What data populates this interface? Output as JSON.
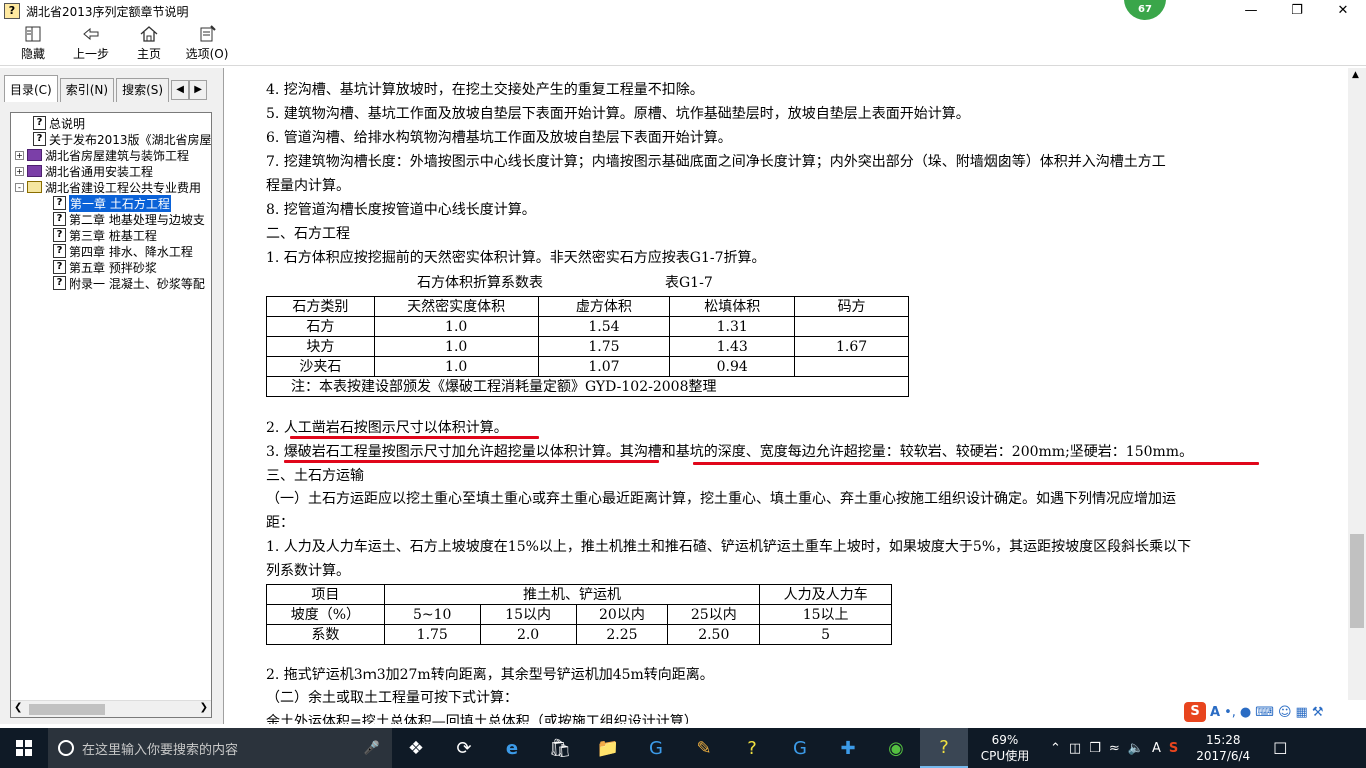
{
  "window": {
    "title": "湖北省2013序列定额章节说明",
    "badge": "67"
  },
  "toolbar": [
    {
      "label": "隐藏",
      "icon": "hide-icon"
    },
    {
      "label": "上一步",
      "icon": "back-arrow-icon"
    },
    {
      "label": "主页",
      "icon": "home-icon"
    },
    {
      "label": "选项(O)",
      "icon": "options-icon"
    }
  ],
  "tabs": [
    "目录(C)",
    "索引(N)",
    "搜索(S)"
  ],
  "tree": [
    {
      "label": "总说明",
      "type": "page",
      "indent": 1
    },
    {
      "label": "关于发布2013版《湖北省房屋",
      "type": "page",
      "indent": 1
    },
    {
      "label": "湖北省房屋建筑与装饰工程",
      "type": "book",
      "indent": 0,
      "expander": "+"
    },
    {
      "label": "湖北省通用安装工程",
      "type": "book",
      "indent": 0,
      "expander": "+"
    },
    {
      "label": "湖北省建设工程公共专业费用",
      "type": "book-open",
      "indent": 0,
      "expander": "-"
    },
    {
      "label": "第一章 土石方工程",
      "type": "page",
      "indent": 2,
      "selected": true
    },
    {
      "label": "第二章 地基处理与边坡支",
      "type": "page",
      "indent": 2
    },
    {
      "label": "第三章 桩基工程",
      "type": "page",
      "indent": 2
    },
    {
      "label": "第四章 排水、降水工程",
      "type": "page",
      "indent": 2
    },
    {
      "label": "第五章 预拌砂浆",
      "type": "page",
      "indent": 2
    },
    {
      "label": "附录一 混凝土、砂浆等配",
      "type": "page",
      "indent": 2
    }
  ],
  "content": {
    "l1": "4. 挖沟槽、基坑计算放坡时，在挖土交接处产生的重复工程量不扣除。",
    "l2": "5. 建筑物沟槽、基坑工作面及放坡自垫层下表面开始计算。原槽、坑作基础垫层时，放坡自垫层上表面开始计算。",
    "l3": "6. 管道沟槽、给排水构筑物沟槽基坑工作面及放坡自垫层下表面开始计算。",
    "l4": "7. 挖建筑物沟槽长度：外墙按图示中心线长度计算；内墙按图示基础底面之间净长度计算；内外突出部分（垛、附墙烟囱等）体积并入沟槽土方工",
    "l5": "程量内计算。",
    "l6": "8. 挖管道沟槽长度按管道中心线长度计算。",
    "l7": "二、石方工程",
    "l8": "1. 石方体积应按挖掘前的天然密实体积计算。非天然密实石方应按表G1-7折算。",
    "table1_caption": "石方体积折算系数表",
    "table1_code": "表G1-7",
    "table1_header": [
      "石方类别",
      "天然密实度体积",
      "虚方体积",
      "松填体积",
      "码方"
    ],
    "table1_rows": [
      [
        "石方",
        "1.0",
        "1.54",
        "1.31",
        ""
      ],
      [
        "块方",
        "1.0",
        "1.75",
        "1.43",
        "1.67"
      ],
      [
        "沙夹石",
        "1.0",
        "1.07",
        "0.94",
        ""
      ]
    ],
    "table1_note": "注：本表按建设部颁发《爆破工程消耗量定额》GYD-102-2008整理",
    "l9_prefix": "2. ",
    "l9_text": "人工凿岩石按图示尺寸以体积计算。",
    "l10_prefix": "3. ",
    "l10_part1": "爆破岩石工程量按图示尺寸加允许超挖量以体积计算",
    "l10_mid": "。其",
    "l10_part2": "沟槽和基坑的深度、宽度每边允许超挖量：较软岩、较硬岩：200mm;坚硬岩：150mm",
    "l10_end": "。",
    "l11": "三、土石方运输",
    "l12": "（一）土石方运距应以挖土重心至填土重心或弃土重心最近距离计算，挖土重心、填土重心、弃土重心按施工组织设计确定。如遇下列情况应增加运",
    "l13": "距：",
    "l14": "1. 人力及人力车运土、石方上坡坡度在15%以上，推土机推土和推石碴、铲运机铲运土重车上坡时，如果坡度大于5%，其运距按坡度区段斜长乘以下",
    "l15": "列系数计算。",
    "table2_h1": [
      "项目",
      "推土机、铲运机",
      "人力及人力车"
    ],
    "table2_r1": [
      "坡度（%）",
      "5~10",
      "15以内",
      "20以内",
      "25以内",
      "15以上"
    ],
    "table2_r2": [
      "系数",
      "1.75",
      "2.0",
      "2.25",
      "2.50",
      "5"
    ],
    "l16": "2. 拖式铲运机3ｍ3加27m转向距离，其余型号铲运机加45m转向距离。",
    "l17": "（二）余土或取土工程量可按下式计算：",
    "l18": "余土外运体积=挖土总体积—回填土总体积（或按施工组织设计计算）"
  },
  "ime": {
    "text_icon": "A"
  },
  "taskbar": {
    "search_placeholder": "在这里输入你要搜索的内容",
    "cpu_percent": "69%",
    "cpu_label": "CPU使用",
    "time": "15:28",
    "date": "2017/6/4",
    "tray_ime": "A"
  },
  "colors": {
    "underline": "#e0061a",
    "selection": "#0a62d8",
    "taskbar": "#0f1a26"
  }
}
